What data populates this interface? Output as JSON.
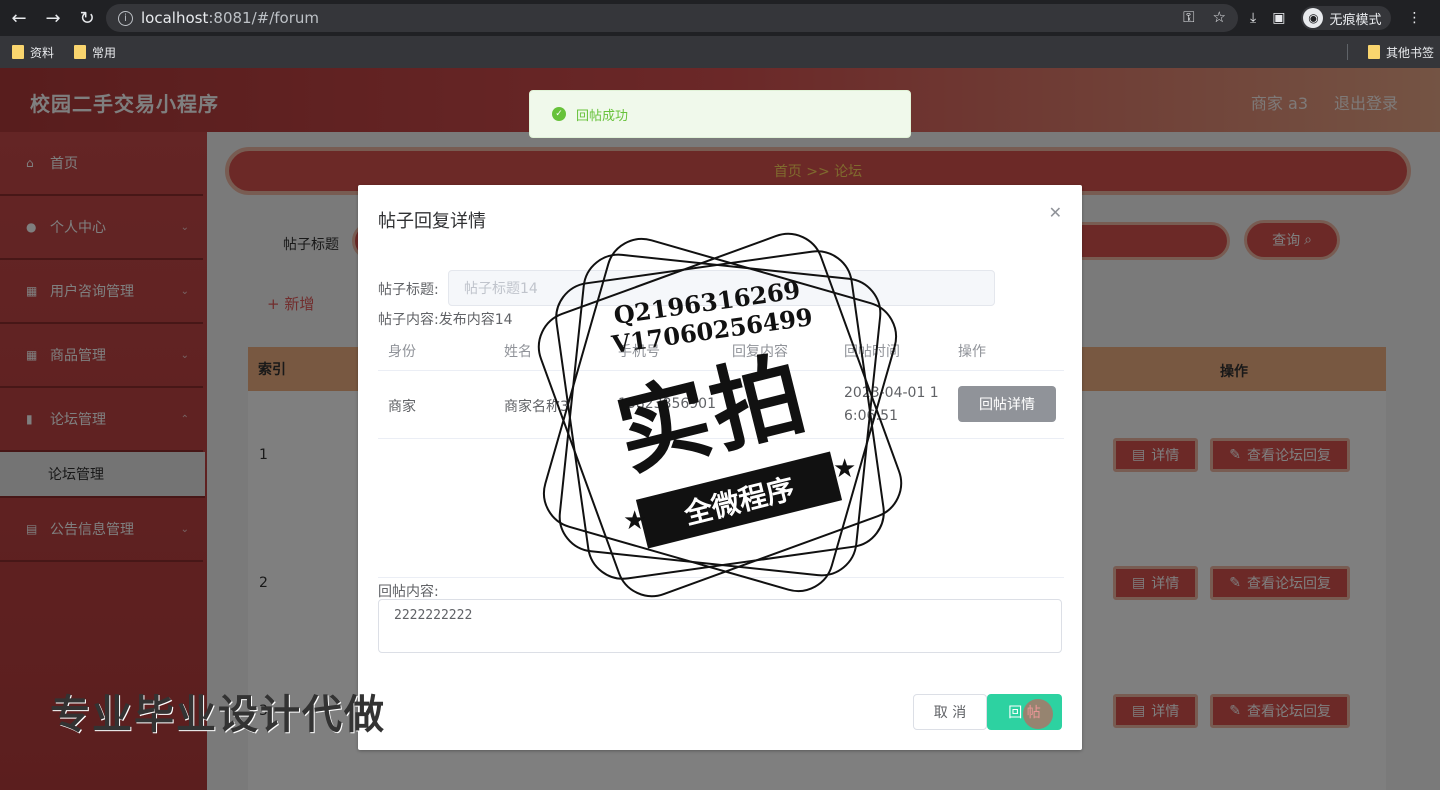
{
  "browser": {
    "url_host": "localhost",
    "url_rest": ":8081/#/forum",
    "incognito_label": "无痕模式",
    "bookmarks": [
      "资料",
      "常用"
    ],
    "other_bookmarks": "其他书签"
  },
  "app": {
    "title": "校园二手交易小程序",
    "user": "商家 a3",
    "logout": "退出登录"
  },
  "sidebar": {
    "items": [
      {
        "label": "首页",
        "icon": "home-icon"
      },
      {
        "label": "个人中心",
        "icon": "user-icon"
      },
      {
        "label": "用户咨询管理",
        "icon": "grid-icon"
      },
      {
        "label": "商品管理",
        "icon": "grid-icon"
      },
      {
        "label": "论坛管理",
        "icon": "chart-icon"
      }
    ],
    "subitem": "论坛管理",
    "last_item": {
      "label": "公告信息管理",
      "icon": "clipboard-icon"
    }
  },
  "main": {
    "breadcrumb": "首页 >> 论坛",
    "search_label": "帖子标题",
    "query_button": "查询",
    "add_button": "+ 新增",
    "table": {
      "headers": {
        "index": "索引",
        "ops": "操作"
      },
      "rows": [
        {
          "index": "1",
          "detail": "详情",
          "view_reply": "查看论坛回复"
        },
        {
          "index": "2",
          "detail": "详情",
          "view_reply": "查看论坛回复"
        },
        {
          "index": "3",
          "detail": "详情",
          "view_reply": "查看论坛回复"
        }
      ]
    }
  },
  "toast": {
    "message": "回帖成功"
  },
  "dialog": {
    "title": "帖子回复详情",
    "post_title_label": "帖子标题:",
    "post_title_value": "帖子标题14",
    "post_content_label": "帖子内容:",
    "post_content_value": "发布内容14",
    "reply_table": {
      "headers": [
        "身份",
        "姓名",
        "手机号",
        "回复内容",
        "回帖时间",
        "操作"
      ],
      "row": {
        "identity": "商家",
        "name": "商家名称3",
        "phone": "13823856901",
        "time_line1": "2023-04-01 1",
        "time_line2": "6:06:51",
        "button": "回帖详情"
      }
    },
    "reply_label": "回帖内容:",
    "reply_value": "2222222222",
    "cancel": "取 消",
    "submit": "回 帖"
  },
  "watermark": {
    "qq": "Q2196316269",
    "vx": "V17060256499",
    "big": "实拍",
    "banner": "全微程序",
    "bottom": "专业毕业设计代做"
  }
}
